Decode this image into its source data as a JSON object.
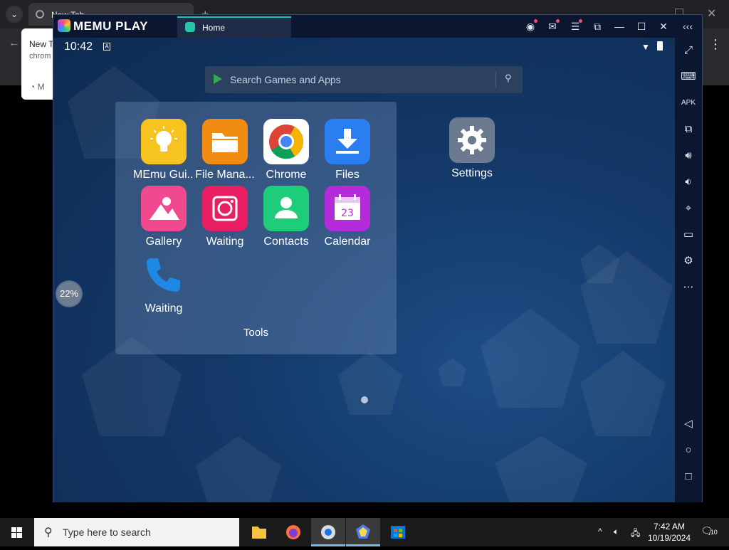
{
  "browser": {
    "tab_title": "New Tab",
    "popup_title": "New T",
    "popup_sub": "chrom",
    "popup_item": "M"
  },
  "window": {
    "brand": "MEMU PLAY",
    "tab_label": "Home"
  },
  "status_bar": {
    "time": "10:42",
    "a_badge": "A"
  },
  "search": {
    "placeholder": "Search Games and Apps"
  },
  "folder": {
    "name": "Tools",
    "apps": [
      {
        "label": "MEmu Gui...",
        "icon": "lightbulb-icon",
        "color": "#f7c31f"
      },
      {
        "label": "File Mana...",
        "icon": "folder-icon",
        "color": "#f08c12"
      },
      {
        "label": "Chrome",
        "icon": "chrome-icon",
        "color": "#ffffff"
      },
      {
        "label": "Files",
        "icon": "download-icon",
        "color": "#2a7ef0"
      },
      {
        "label": "Gallery",
        "icon": "image-icon",
        "color": "#f0498f"
      },
      {
        "label": "Waiting",
        "icon": "camera-icon",
        "color": "#e91e63"
      },
      {
        "label": "Contacts",
        "icon": "person-icon",
        "color": "#1fcc7a"
      },
      {
        "label": "Calendar",
        "icon": "calendar-icon",
        "color": "#b52bd9"
      },
      {
        "label": "Waiting",
        "icon": "phone-icon",
        "color": "#1e88e5"
      }
    ]
  },
  "desktop": {
    "settings_label": "Settings",
    "progress_text": "22%",
    "progress": 22
  },
  "taskbar": {
    "search_placeholder": "Type here to search",
    "time": "7:42 AM",
    "date": "10/19/2024",
    "notification_count": "10"
  }
}
